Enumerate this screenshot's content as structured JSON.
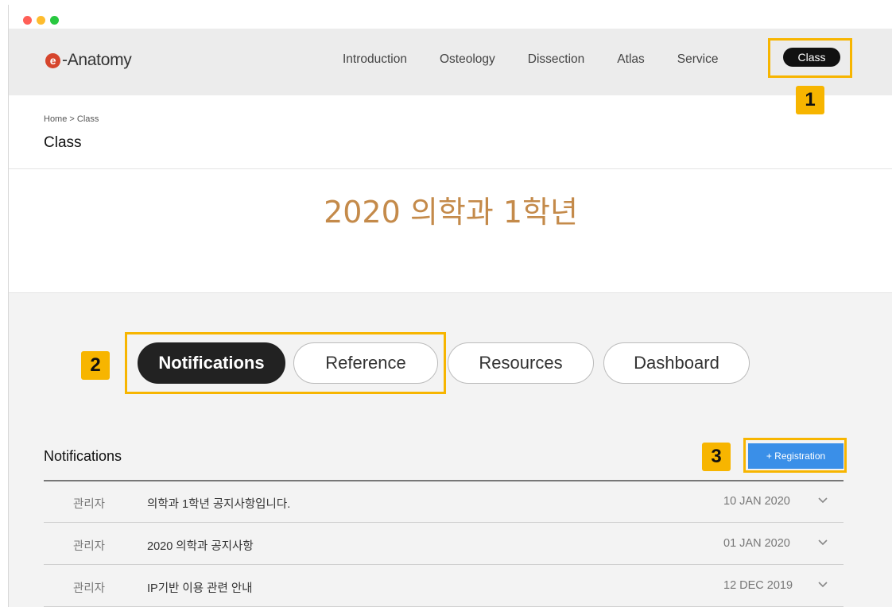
{
  "brand": {
    "logo_mark": "e",
    "name": "-Anatomy"
  },
  "nav": {
    "items": [
      "Introduction",
      "Osteology",
      "Dissection",
      "Atlas",
      "Service"
    ],
    "active": "Class"
  },
  "breadcrumb": "Home > Class",
  "page_title": "Class",
  "class_title": "2020 의학과 1학년",
  "tabs": [
    "Notifications",
    "Reference",
    "Resources",
    "Dashboard"
  ],
  "active_tab": "Notifications",
  "section": {
    "title": "Notifications",
    "registration_button": "+ Registration"
  },
  "notifications": [
    {
      "author": "관리자",
      "subject": "의학과 1학년 공지사항입니다.",
      "date": "10 JAN 2020"
    },
    {
      "author": "관리자",
      "subject": "2020 의학과 공지사항",
      "date": "01 JAN 2020"
    },
    {
      "author": "관리자",
      "subject": "IP기반 이용 관련 안내",
      "date": "12 DEC 2019"
    }
  ],
  "callouts": [
    "1",
    "2",
    "3"
  ],
  "colors": {
    "accent_title": "#c48a4a",
    "callout": "#f7b500",
    "button_blue": "#3a8fe8",
    "logo": "#d6452c"
  }
}
